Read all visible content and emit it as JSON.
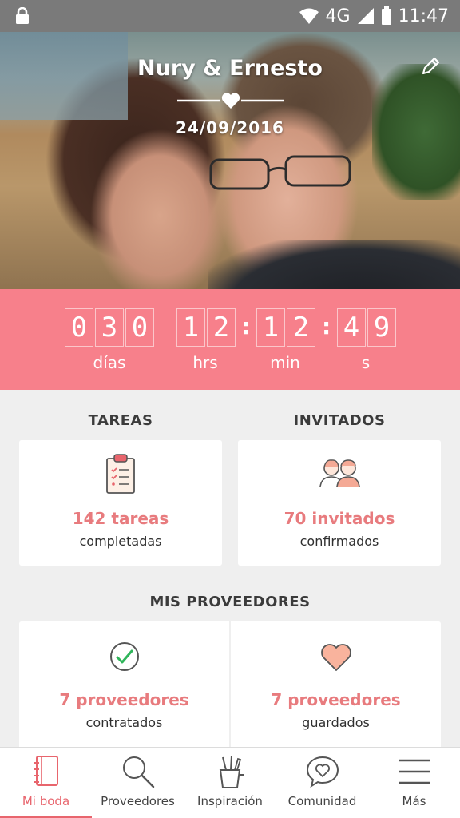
{
  "status_bar": {
    "network": "4G",
    "time": "11:47"
  },
  "header": {
    "couple_name": "Nury & Ernesto",
    "wedding_date": "24/09/2016"
  },
  "countdown": {
    "days": [
      "0",
      "3",
      "0"
    ],
    "hours": [
      "1",
      "2"
    ],
    "minutes": [
      "1",
      "2"
    ],
    "seconds": [
      "4",
      "9"
    ],
    "separator": ":",
    "labels": {
      "days": "días",
      "hours": "hrs",
      "minutes": "min",
      "seconds": "s"
    }
  },
  "tasks": {
    "section_title": "TAREAS",
    "count_text": "142 tareas",
    "caption": "completadas"
  },
  "guests": {
    "section_title": "INVITADOS",
    "count_text": "70 invitados",
    "caption": "confirmados"
  },
  "vendors": {
    "section_title": "MIS PROVEEDORES",
    "hired": {
      "count_text": "7 proveedores",
      "caption": "contratados"
    },
    "saved": {
      "count_text": "7 proveedores",
      "caption": "guardados"
    }
  },
  "bottom_nav": {
    "items": [
      {
        "label": "Mi boda",
        "icon": "notebook-icon",
        "active": true
      },
      {
        "label": "Proveedores",
        "icon": "search-icon",
        "active": false
      },
      {
        "label": "Inspiración",
        "icon": "pencil-cup-icon",
        "active": false
      },
      {
        "label": "Comunidad",
        "icon": "chat-heart-icon",
        "active": false
      },
      {
        "label": "Más",
        "icon": "menu-icon",
        "active": false
      }
    ]
  },
  "colors": {
    "accent": "#f7808b",
    "accent_text": "#e87b7e",
    "nav_active": "#e8656d",
    "status_bar": "#7a7a7a"
  }
}
